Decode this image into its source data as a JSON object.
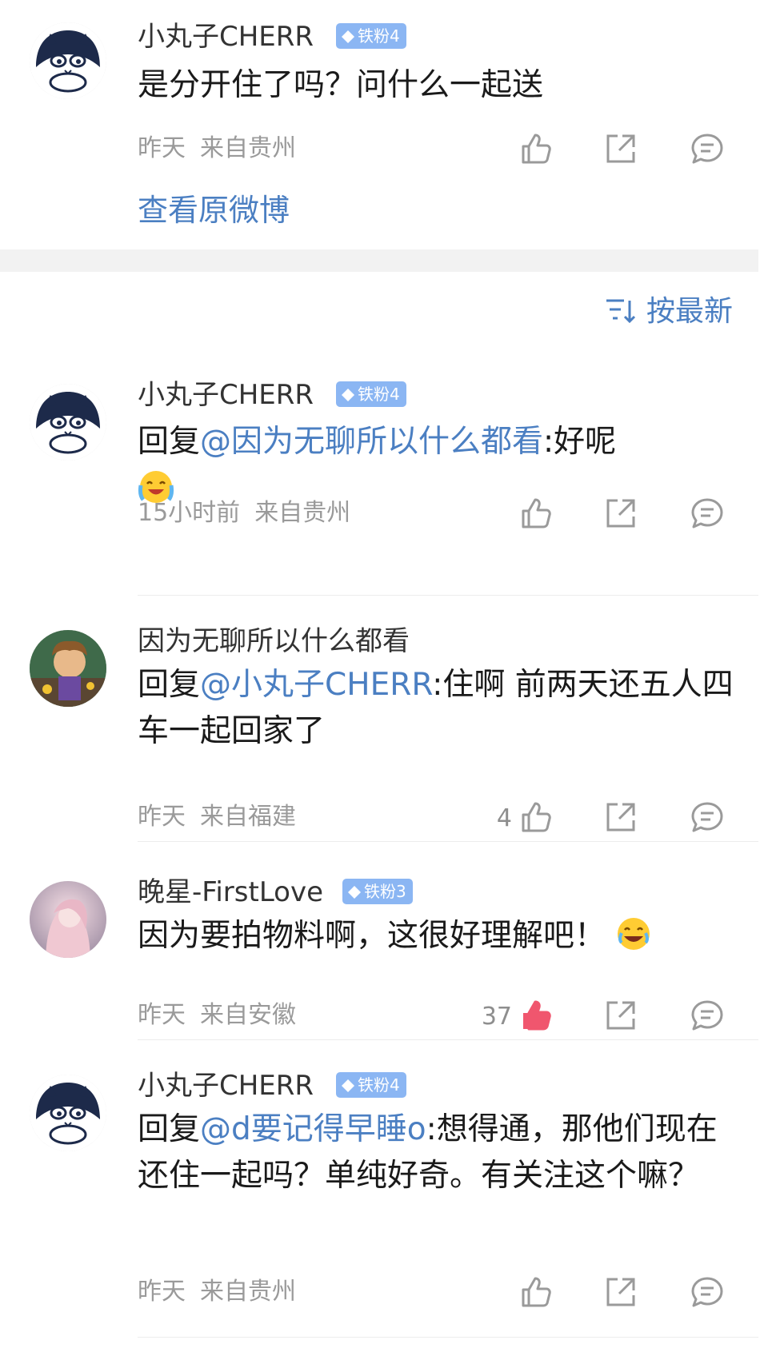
{
  "original": {
    "user": "小丸子CHERR",
    "badge": "铁粉4",
    "text": "是分开住了吗？问什么一起送",
    "time": "昨天",
    "location": "来自贵州",
    "view_original": "查看原微博"
  },
  "sort": {
    "label": "按最新"
  },
  "comments": [
    {
      "user": "小丸子CHERR",
      "badge": "铁粉4",
      "prefix": "回复",
      "mention": "@因为无聊所以什么都看",
      "text": ":好呢",
      "emoji": "crying-laughing-emoji",
      "time": "15小时前",
      "location": "来自贵州",
      "likes": ""
    },
    {
      "user": "因为无聊所以什么都看",
      "badge": "",
      "prefix": "回复",
      "mention": "@小丸子CHERR",
      "text": ":住啊 前两天还五人四车一起回家了",
      "time": "昨天",
      "location": "来自福建",
      "likes": "4"
    },
    {
      "user": "晚星-FirstLove",
      "badge": "铁粉3",
      "prefix": "",
      "mention": "",
      "text": "因为要拍物料啊，这很好理解吧！",
      "emoji": "laughing-tears-emoji",
      "time": "昨天",
      "location": "来自安徽",
      "likes": "37",
      "liked": true
    },
    {
      "user": "小丸子CHERR",
      "badge": "铁粉4",
      "prefix": "回复",
      "mention": "@d要记得早睡o",
      "text": ":想得通，那他们现在还住一起吗？单纯好奇。有关注这个嘛？",
      "time": "昨天",
      "location": "来自贵州",
      "likes": ""
    }
  ],
  "colors": {
    "link": "#4b7fc2",
    "badge": "#8bb6f3",
    "liked": "#f0566e",
    "muted": "#9a9a9a"
  }
}
